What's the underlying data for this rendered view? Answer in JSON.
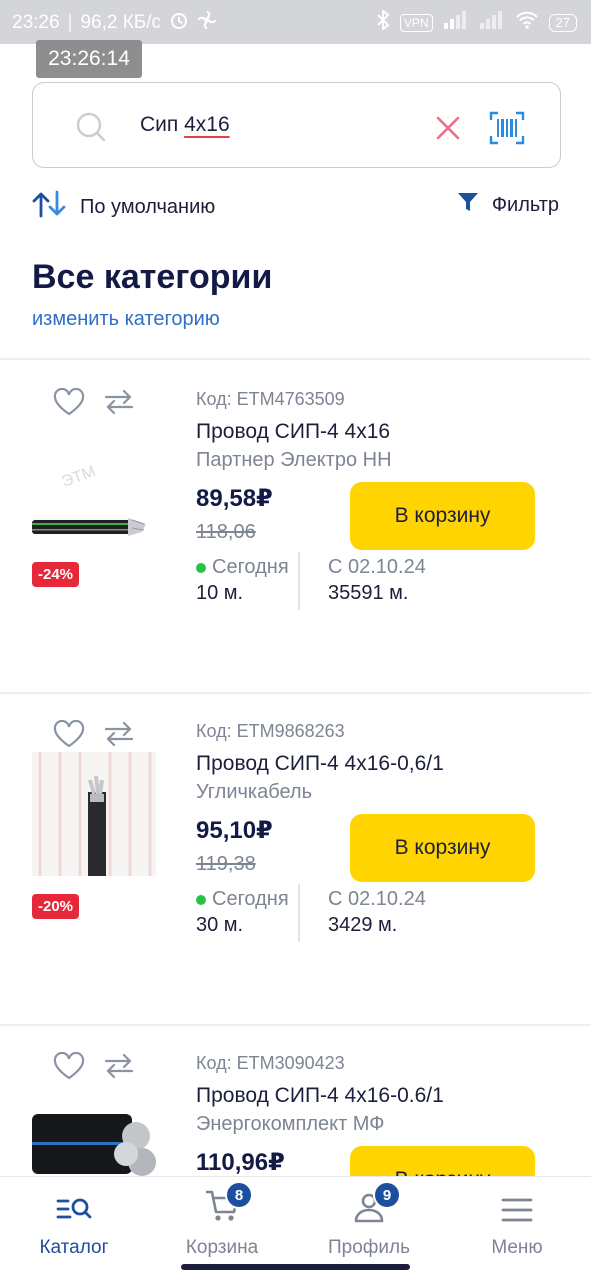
{
  "statusbar": {
    "time": "23:26",
    "speed": "96,2 КБ/с",
    "vpn": "VPN",
    "battery": "27"
  },
  "overlay_clock": "23:26:14",
  "search": {
    "query_prefix": "Сип ",
    "query_suffix": "4х16"
  },
  "sort": {
    "label": "По умолчанию"
  },
  "filter": {
    "label": "Фильтр"
  },
  "page": {
    "title": "Все категории",
    "change_category": "изменить категорию"
  },
  "products": [
    {
      "code": "Код: ETM4763509",
      "name": "Провод СИП-4 4х16",
      "brand": "Партнер Электро НН",
      "price": "89,58₽",
      "old_price": "118,06",
      "discount": "-24%",
      "cart_label": "В корзину",
      "avail_today": "Сегодня",
      "qty_today": "10 м.",
      "avail_date": "С 02.10.24",
      "qty_date": "35591 м."
    },
    {
      "code": "Код: ETM9868263",
      "name": "Провод СИП-4 4х16-0,6/1",
      "brand": "Угличкабель",
      "price": "95,10₽",
      "old_price": "119,38",
      "discount": "-20%",
      "cart_label": "В корзину",
      "avail_today": "Сегодня",
      "qty_today": "30 м.",
      "avail_date": "С 02.10.24",
      "qty_date": "3429 м."
    },
    {
      "code": "Код: ETM3090423",
      "name": "Провод СИП-4 4х16-0.6/1",
      "brand": "Энергокомплект МФ",
      "price": "110,96₽",
      "cart_label": "В корзину"
    }
  ],
  "nav": {
    "catalog": "Каталог",
    "cart": "Корзина",
    "cart_count": "8",
    "profile": "Профиль",
    "profile_count": "9",
    "menu": "Меню"
  },
  "colors": {
    "accent": "#1d4fa0",
    "cart_button": "#ffd400",
    "discount": "#e5283a",
    "in_stock": "#27c24c",
    "link": "#2f6fc4"
  }
}
